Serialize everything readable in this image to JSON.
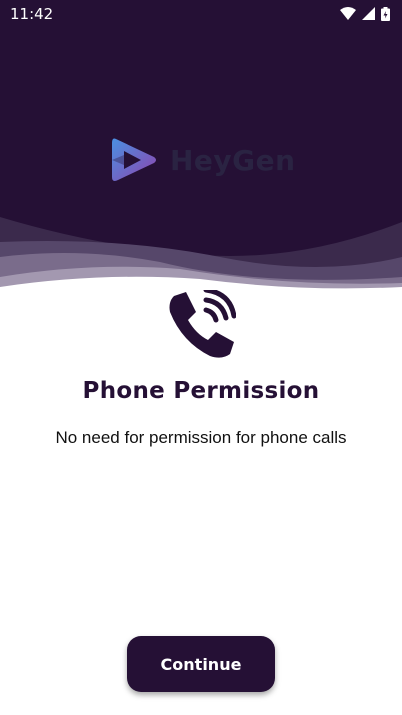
{
  "status_bar": {
    "time": "11:42",
    "icons": [
      "wifi-icon",
      "signal-icon",
      "battery-icon"
    ]
  },
  "logo": {
    "text": "HeyGen",
    "icon": "play-logo-icon"
  },
  "permission": {
    "icon": "phone-call-icon",
    "title": "Phone Permission",
    "description": "No need for permission for phone calls"
  },
  "actions": {
    "continue_label": "Continue"
  },
  "colors": {
    "primary": "#251035",
    "background": "#ffffff",
    "logo_gradient_start": "#4a90e2",
    "logo_gradient_end": "#8e44ad"
  }
}
